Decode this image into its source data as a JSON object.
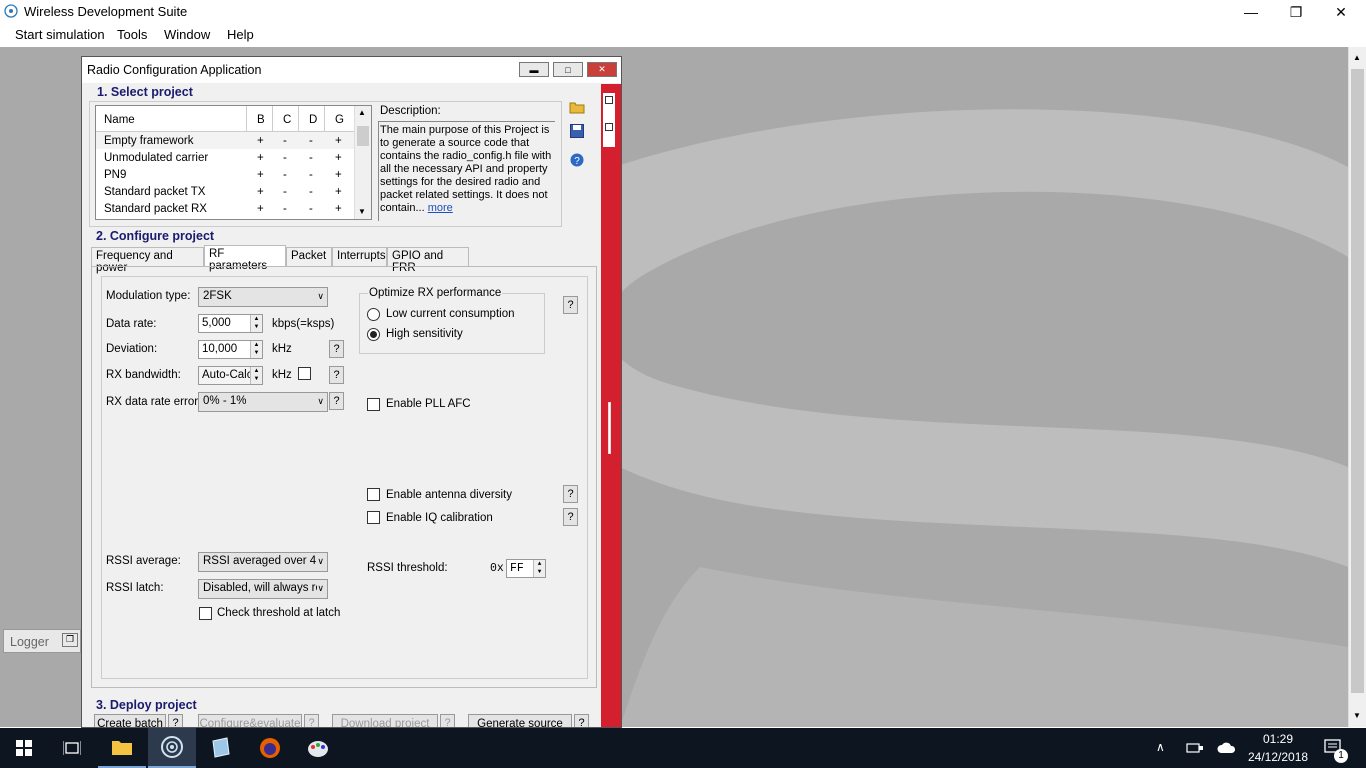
{
  "app": {
    "title": "Wireless Development Suite",
    "menu": [
      "Start simulation",
      "Tools",
      "Window",
      "Help"
    ]
  },
  "logger": {
    "label": "Logger"
  },
  "dialog": {
    "title": "Radio Configuration Application",
    "section1": "1. Select project",
    "section2": "2. Configure project",
    "section3": "3. Deploy project",
    "project_table": {
      "headers": [
        "Name",
        "B",
        "C",
        "D",
        "G"
      ],
      "rows": [
        [
          "Empty framework",
          "+",
          "-",
          "-",
          "+"
        ],
        [
          "Unmodulated carrier",
          "+",
          "-",
          "-",
          "+"
        ],
        [
          "PN9",
          "+",
          "-",
          "-",
          "+"
        ],
        [
          "Standard packet TX",
          "+",
          "-",
          "-",
          "+"
        ],
        [
          "Standard packet RX",
          "+",
          "-",
          "-",
          "+"
        ]
      ]
    },
    "description_label": "Description:",
    "description_text": "The main purpose of this Project is to generate a source code that contains the radio_config.h file with all the necessary API and property settings for the desired radio and packet related settings. It does not contain...",
    "description_more": "more",
    "tabs": [
      "Frequency and power",
      "RF parameters",
      "Packet",
      "Interrupts",
      "GPIO and FRR"
    ],
    "active_tab": "RF parameters",
    "rf": {
      "modulation_label": "Modulation type:",
      "modulation_value": "2FSK",
      "data_rate_label": "Data rate:",
      "data_rate_value": "5,000",
      "data_rate_unit": "kbps(=ksps)",
      "deviation_label": "Deviation:",
      "deviation_value": "10,000",
      "deviation_unit": "kHz",
      "rx_bw_label": "RX bandwidth:",
      "rx_bw_value": "Auto-Calc",
      "rx_bw_unit": "kHz",
      "rx_err_label": "RX data rate error:",
      "rx_err_value": "0% - 1%",
      "optimize_title": "Optimize RX performance",
      "opt_low": "Low current consumption",
      "opt_high": "High sensitivity",
      "pll_afc": "Enable PLL AFC",
      "antenna_div": "Enable antenna diversity",
      "iq_cal": "Enable IQ calibration",
      "rssi_avg_label": "RSSI average:",
      "rssi_avg_value": "RSSI averaged over 4",
      "rssi_latch_label": "RSSI latch:",
      "rssi_latch_value": "Disabled, will always re",
      "check_threshold": "Check threshold at latch",
      "rssi_thr_label": "RSSI threshold:",
      "rssi_thr_prefix": "0x",
      "rssi_thr_value": "FF",
      "help": "?"
    },
    "deploy": {
      "create_batch": "Create batch",
      "configure": "Configure&evaluate",
      "download": "Download project",
      "generate": "Generate source"
    }
  },
  "taskbar": {
    "time": "01:29",
    "date": "24/12/2018",
    "notifications": "1"
  }
}
